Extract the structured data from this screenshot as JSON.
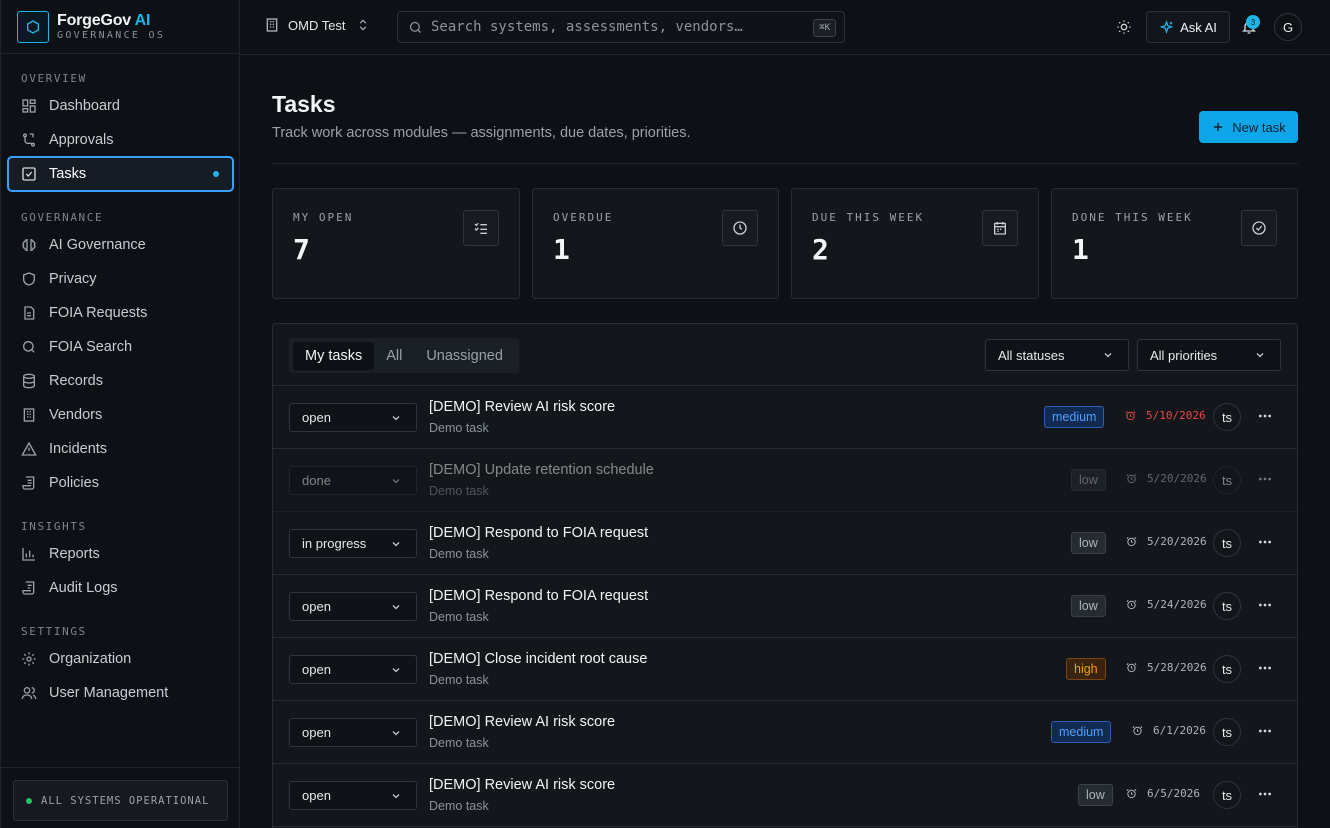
{
  "brand": {
    "name": "ForgeGov",
    "name_accent": "AI",
    "subtitle": "GOVERNANCE OS"
  },
  "sidebar": {
    "sections": [
      {
        "label": "OVERVIEW"
      },
      {
        "label": "GOVERNANCE"
      },
      {
        "label": "INSIGHTS"
      },
      {
        "label": "SETTINGS"
      }
    ],
    "items": [
      {
        "label": "Dashboard",
        "icon": "grid-icon"
      },
      {
        "label": "Approvals",
        "icon": "git-branch-icon"
      },
      {
        "label": "Tasks",
        "icon": "checkbox-icon",
        "active": true
      },
      {
        "label": "AI Governance",
        "icon": "brain-icon"
      },
      {
        "label": "Privacy",
        "icon": "shield-icon"
      },
      {
        "label": "FOIA Requests",
        "icon": "file-icon"
      },
      {
        "label": "FOIA Search",
        "icon": "search-icon"
      },
      {
        "label": "Records",
        "icon": "database-icon"
      },
      {
        "label": "Vendors",
        "icon": "building-icon"
      },
      {
        "label": "Incidents",
        "icon": "alert-triangle-icon"
      },
      {
        "label": "Policies",
        "icon": "scroll-icon"
      },
      {
        "label": "Reports",
        "icon": "bar-chart-icon"
      },
      {
        "label": "Audit Logs",
        "icon": "log-icon"
      },
      {
        "label": "Organization",
        "icon": "gear-icon"
      },
      {
        "label": "User Management",
        "icon": "users-icon"
      }
    ],
    "status": "ALL SYSTEMS OPERATIONAL"
  },
  "topbar": {
    "org": "OMD Test",
    "search_placeholder": "Search systems, assessments, vendors…",
    "search_shortcut": "⌘K",
    "ask_ai": "Ask AI",
    "notifications": "3",
    "user_initial": "G"
  },
  "page": {
    "title": "Tasks",
    "subtitle": "Track work across modules — assignments, due dates, priorities.",
    "new_task": "New task"
  },
  "stats": [
    {
      "label": "MY OPEN",
      "value": "7",
      "icon": "list-check-icon"
    },
    {
      "label": "OVERDUE",
      "value": "1",
      "icon": "clock-icon"
    },
    {
      "label": "DUE THIS WEEK",
      "value": "2",
      "icon": "calendar-icon"
    },
    {
      "label": "DONE THIS WEEK",
      "value": "1",
      "icon": "check-circle-icon"
    }
  ],
  "tabs": [
    "My tasks",
    "All",
    "Unassigned"
  ],
  "filters": {
    "status": "All statuses",
    "priority": "All priorities"
  },
  "tasks": [
    {
      "status": "open",
      "title": "[DEMO] Review AI risk score",
      "sub": "Demo task",
      "priority": "medium",
      "due": "5/10/2026",
      "overdue": true,
      "assignee": "ts"
    },
    {
      "status": "done",
      "title": "[DEMO] Update retention schedule",
      "sub": "Demo task",
      "priority": "low",
      "due": "5/20/2026",
      "assignee": "ts"
    },
    {
      "status": "in progress",
      "title": "[DEMO] Respond to FOIA request",
      "sub": "Demo task",
      "priority": "low",
      "due": "5/20/2026",
      "assignee": "ts"
    },
    {
      "status": "open",
      "title": "[DEMO] Respond to FOIA request",
      "sub": "Demo task",
      "priority": "low",
      "due": "5/24/2026",
      "assignee": "ts"
    },
    {
      "status": "open",
      "title": "[DEMO] Close incident root cause",
      "sub": "Demo task",
      "priority": "high",
      "due": "5/28/2026",
      "assignee": "ts"
    },
    {
      "status": "open",
      "title": "[DEMO] Review AI risk score",
      "sub": "Demo task",
      "priority": "medium",
      "due": "6/1/2026",
      "assignee": "ts"
    },
    {
      "status": "open",
      "title": "[DEMO] Review AI risk score",
      "sub": "Demo task",
      "priority": "low",
      "due": "6/5/2026",
      "assignee": "ts"
    }
  ],
  "colors": {
    "accent": "#1fb6e6",
    "overdue": "#f04444",
    "medium": "#4ea1ff",
    "high": "#f59e0b",
    "operational": "#22c55e"
  }
}
